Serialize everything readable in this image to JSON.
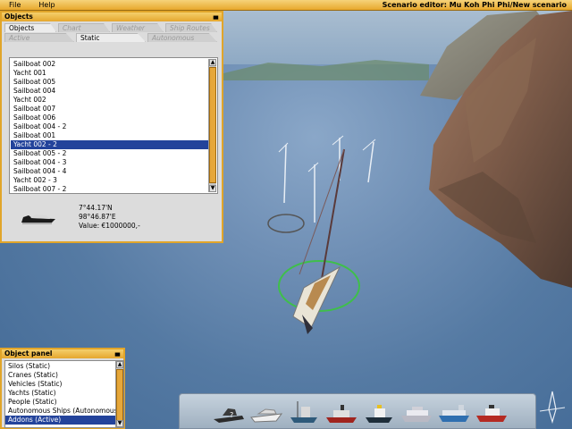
{
  "menubar": {
    "items": [
      "File",
      "Help"
    ],
    "title": "Scenario editor: Mu Koh Phi Phi/New scenario"
  },
  "objects_window": {
    "title": "Objects",
    "minimize_glyph": "▄",
    "tabs": [
      {
        "label": "Objects",
        "active": true
      },
      {
        "label": "Chart",
        "active": false
      },
      {
        "label": "Weather",
        "active": false
      },
      {
        "label": "Ship Routes",
        "active": false
      }
    ],
    "subtabs": [
      {
        "label": "Active",
        "active": false
      },
      {
        "label": "Static",
        "active": true
      },
      {
        "label": "Autonomous",
        "active": false
      }
    ],
    "list": [
      "Sailboat 002",
      "Yacht 001",
      "Sailboat 005",
      "Sailboat 004",
      "Yacht 002",
      "Sailboat 007",
      "Sailboat 006",
      "Sailboat 004 - 2",
      "Sailboat 001",
      "Yacht 002 - 2",
      "Sailboat 005 - 2",
      "Sailboat 004 - 3",
      "Sailboat 004 - 4",
      "Yacht 002 - 3",
      "Sailboat 007 - 2"
    ],
    "selected_index": 9,
    "details": {
      "lat": "7°44.17'N",
      "lon": "98°46.87'E",
      "value": "Value: €1000000,-"
    }
  },
  "object_panel": {
    "title": "Object panel",
    "items": [
      "Silos (Static)",
      "Cranes (Static)",
      "Vehicles (Static)",
      "Yachts (Static)",
      "People (Static)",
      "Autonomous Ships (Autonomous)",
      "Addons (Active)"
    ],
    "selected_index": 6
  },
  "vessel_bar": {
    "items": [
      "patrol-boat",
      "motor-yacht",
      "trawler",
      "tugboat",
      "fishing-boat",
      "ferry",
      "container-ship",
      "fire-tug"
    ]
  },
  "colors": {
    "accent": "#e5a72e",
    "selection": "#23439b"
  }
}
